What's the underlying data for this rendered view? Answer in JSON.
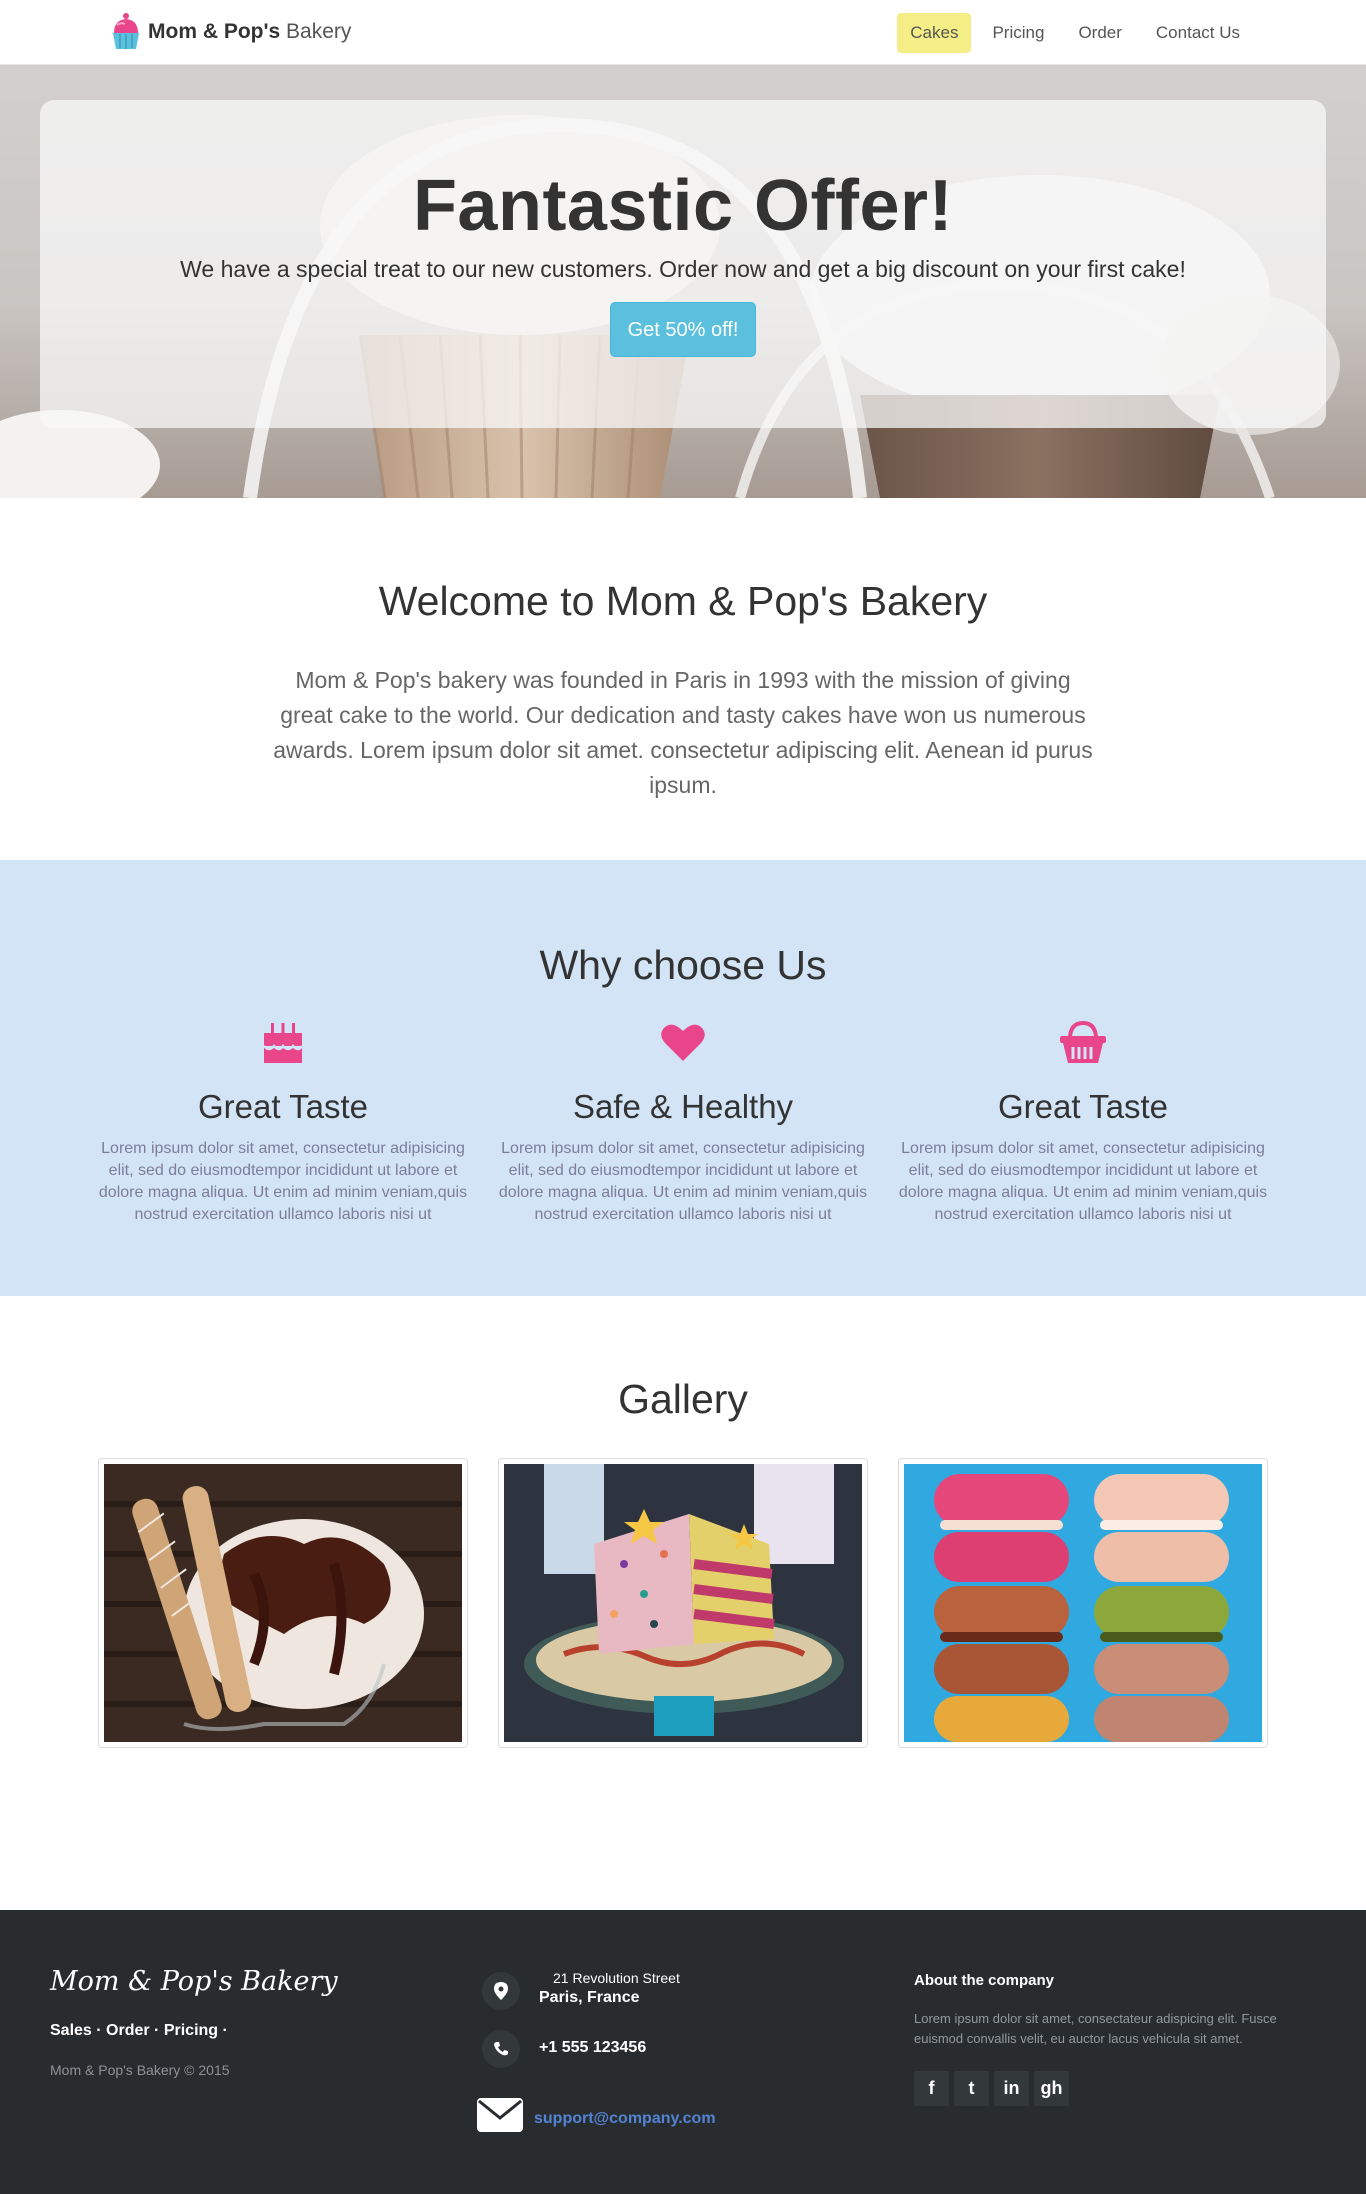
{
  "brand": {
    "bold": "Mom & Pop's",
    "light": "Bakery"
  },
  "nav": {
    "items": [
      "Cakes",
      "Pricing",
      "Order",
      "Contact Us"
    ],
    "active": 0
  },
  "hero": {
    "title": "Fantastic Offer!",
    "text": "We have a special treat to our new customers. Order now and get a big discount on your first cake!",
    "button": "Get 50% off!"
  },
  "welcome": {
    "title": "Welcome to Mom & Pop's Bakery",
    "text": "Mom & Pop's bakery was founded in Paris in 1993 with the mission of giving great cake to the world. Our dedication and tasty cakes have won us numerous awards. Lorem ipsum dolor sit amet. consectetur adipiscing elit. Aenean id purus ipsum."
  },
  "why": {
    "title": "Why choose Us",
    "features": [
      {
        "icon": "birthday-cake-icon",
        "title": "Great Taste",
        "text": "Lorem ipsum dolor sit amet, consectetur adipisicing elit, sed do eiusmodtempor incididunt ut labore et dolore magna aliqua. Ut enim ad minim veniam,quis nostrud exercitation ullamco laboris nisi ut"
      },
      {
        "icon": "heart-icon",
        "title": "Safe & Healthy",
        "text": "Lorem ipsum dolor sit amet, consectetur adipisicing elit, sed do eiusmodtempor incididunt ut labore et dolore magna aliqua. Ut enim ad minim veniam,quis nostrud exercitation ullamco laboris nisi ut"
      },
      {
        "icon": "shopping-basket-icon",
        "title": "Great Taste",
        "text": "Lorem ipsum dolor sit amet, consectetur adipisicing elit, sed do eiusmodtempor incididunt ut labore et dolore magna aliqua. Ut enim ad minim veniam,quis nostrud exercitation ullamco laboris nisi ut"
      }
    ],
    "accent": "#e9458b"
  },
  "gallery": {
    "title": "Gallery"
  },
  "footer": {
    "logo": "Mom & Pop's Bakery",
    "links": "Sales · Order · Pricing ·",
    "copyright": "Mom & Pop's Bakery © 2015",
    "address_line1": "21 Revolution Street",
    "address_line2": "Paris, France",
    "phone": "+1 555 123456",
    "email": "support@company.com",
    "about_title": "About the company",
    "about_text": "Lorem ipsum dolor sit amet, consectateur adispicing elit. Fusce euismod convallis velit, eu auctor lacus vehicula sit amet.",
    "social": [
      "f",
      "t",
      "in",
      "gh"
    ]
  }
}
